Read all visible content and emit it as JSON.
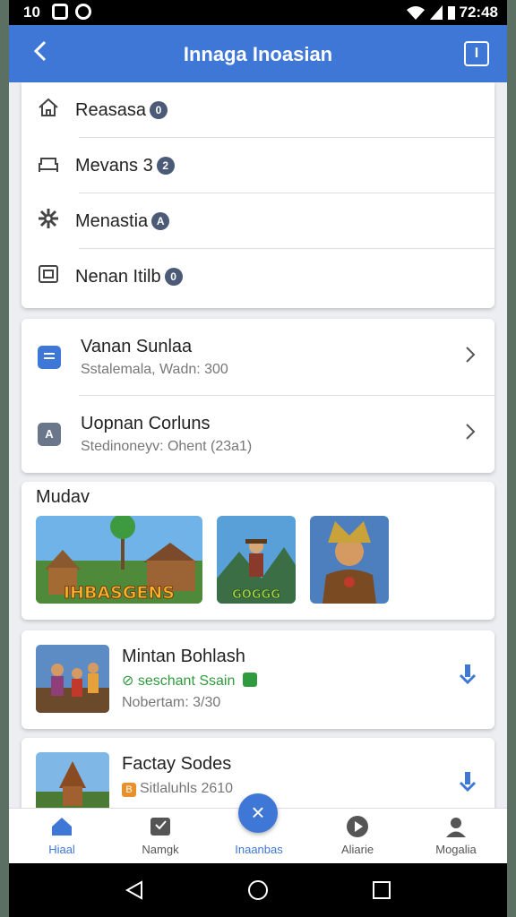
{
  "status_bar": {
    "time_left": "10",
    "time_right": "72:48"
  },
  "app_bar": {
    "title": "Innaga Inoasian",
    "back_icon": "chevron-left-icon",
    "info_label": "I"
  },
  "menu": {
    "items": [
      {
        "label": "Reasasa",
        "badge": "0",
        "icon": "home-icon"
      },
      {
        "label": "Mevans 3",
        "badge": "2",
        "icon": "sofa-icon"
      },
      {
        "label": "Menastia",
        "badge": "A",
        "icon": "gear-icon"
      },
      {
        "label": "Nenan Itilb",
        "badge": "0",
        "icon": "window-icon"
      }
    ]
  },
  "subscriptions": {
    "items": [
      {
        "title": "Vanan Sunlaa",
        "subtitle": "Sstalemala, Wadn: 300",
        "icon_label": "",
        "color": "#3f77d6"
      },
      {
        "title": "Uopnan Corluns",
        "subtitle": "Stedinoneyv: Ohent (23a1)",
        "icon_label": "A",
        "color": "#6a7689"
      }
    ]
  },
  "featured": {
    "title": "Mudav",
    "thumbs": [
      {
        "caption": "IHBASGENS",
        "icon": "village-game-art"
      },
      {
        "caption": "GOGGG",
        "icon": "adventurer-game-art"
      },
      {
        "caption": "",
        "icon": "warrior-game-art"
      }
    ]
  },
  "games": [
    {
      "title": "Mintan Bohlash",
      "status": "seschant Ssain",
      "meta": "Nobertam: 3/30",
      "action_icon": "download-icon"
    },
    {
      "title": "Factay Sodes",
      "status": "Sitlaluhls 2610",
      "meta": "",
      "action_icon": "download-icon"
    }
  ],
  "bottom_nav": {
    "items": [
      {
        "label": "Hiaal",
        "icon": "home-icon",
        "active": true
      },
      {
        "label": "Namgk",
        "icon": "badge-icon",
        "active": false
      },
      {
        "label": "Inaanbas",
        "icon": "close-icon",
        "active": true
      },
      {
        "label": "Aliarie",
        "icon": "play-icon",
        "active": false
      },
      {
        "label": "Mogalia",
        "icon": "profile-icon",
        "active": false
      }
    ],
    "fab_symbol": "×"
  },
  "colors": {
    "primary": "#3f77d6",
    "success": "#2f9a3e",
    "background": "#eceef1"
  }
}
